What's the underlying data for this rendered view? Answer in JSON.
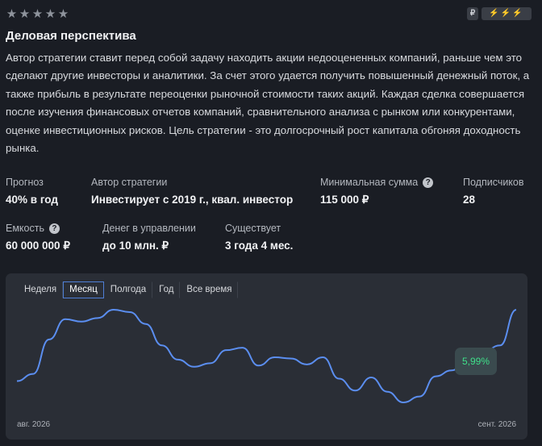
{
  "rating": {
    "stars": 5,
    "star_glyph": "★",
    "color": "#8e939c"
  },
  "badges": {
    "currency_icon": "ruble-icon",
    "currency_glyph": "₽",
    "risk_icon": "lightning-icon",
    "risk_glyphs": "⚡⚡⚡"
  },
  "strategy": {
    "title": "Деловая перспектива",
    "description": "Автор стратегии ставит перед собой задачу находить акции недооцененных компаний, раньше чем это сделают другие инвесторы и аналитики. За счет этого удается получить повышенный денежный поток, а также прибыль в результате переоценки рыночной стоимости таких акций. Каждая сделка совершается после изучения финансовых отчетов компаний, сравнительного анализа с рынком или конкурентами, оценке инвестиционных рисков. Цель стратегии - это долгосрочный рост капитала обгоняя доходность рынка."
  },
  "stats": {
    "forecast": {
      "label": "Прогноз",
      "value": "40% в год"
    },
    "author": {
      "label": "Автор стратегии",
      "value": "Инвестирует с 2019 г., квал. инвестор"
    },
    "min_sum": {
      "label": "Минимальная сумма",
      "value": "115 000 ₽",
      "help": "?"
    },
    "subscribers": {
      "label": "Подписчиков",
      "value": "28"
    },
    "capacity": {
      "label": "Емкость",
      "value": "60 000 000 ₽",
      "help": "?"
    },
    "aum": {
      "label": "Денег в управлении",
      "value": "до 10 млн. ₽"
    },
    "exists": {
      "label": "Существует",
      "value": "3 года 4 мес."
    }
  },
  "chart": {
    "tabs": [
      {
        "label": "Неделя",
        "active": false
      },
      {
        "label": "Месяц",
        "active": true
      },
      {
        "label": "Полгода",
        "active": false
      },
      {
        "label": "Год",
        "active": false
      },
      {
        "label": "Все время",
        "active": false
      }
    ],
    "x_start_label": "авг. 2026",
    "x_end_label": "сент. 2026",
    "tooltip_value": "5,99%",
    "line_color": "#5b8ef0",
    "tooltip_color": "#3fe08a"
  },
  "chart_data": {
    "type": "line",
    "xlabel": "",
    "ylabel": "",
    "x_range_labels": [
      "авг. 2026",
      "сент. 2026"
    ],
    "values": [
      0.0,
      0.6,
      3.5,
      5.2,
      5.0,
      5.3,
      6.0,
      5.8,
      4.8,
      3.0,
      1.8,
      1.2,
      1.5,
      2.6,
      2.8,
      1.3,
      2.0,
      1.9,
      1.4,
      2.0,
      0.2,
      -0.8,
      0.3,
      -0.9,
      -1.8,
      -1.3,
      0.4,
      0.9,
      1.8,
      2.5,
      3.0,
      5.99
    ],
    "tooltip_last": "5,99%"
  }
}
